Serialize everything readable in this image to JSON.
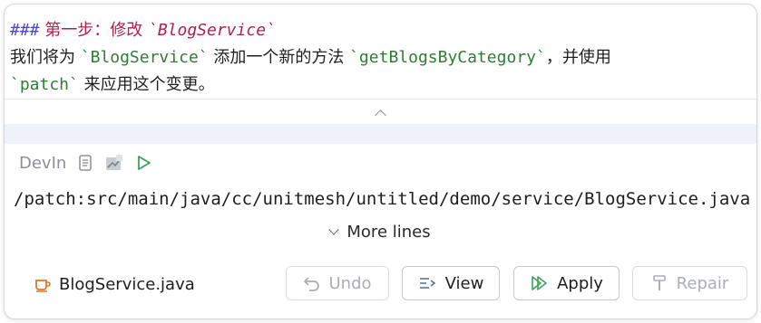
{
  "markdown": {
    "heading_hash": "###",
    "heading_text": "第一步：修改",
    "heading_code": "`BlogService`",
    "line1_pre": "我们将为",
    "line1_code1": "`BlogService`",
    "line1_mid": "添加一个新的方法",
    "line1_code2": "`getBlogsByCategory`",
    "line1_post": "，并使用",
    "line2_code": "`patch`",
    "line2_post": "来应用这个变更。"
  },
  "toolbar": {
    "label": "DevIn",
    "icons": [
      "copy-icon",
      "image-icon",
      "run-icon"
    ]
  },
  "code_block": {
    "command": "/patch:src/main/java/cc/unitmesh/untitled/demo/service/BlogService.java",
    "more_lines_label": "More lines"
  },
  "footer": {
    "file_name": "BlogService.java",
    "file_icon": "java-cup-icon",
    "undo_label": "Undo",
    "view_label": "View",
    "apply_label": "Apply",
    "repair_label": "Repair"
  }
}
